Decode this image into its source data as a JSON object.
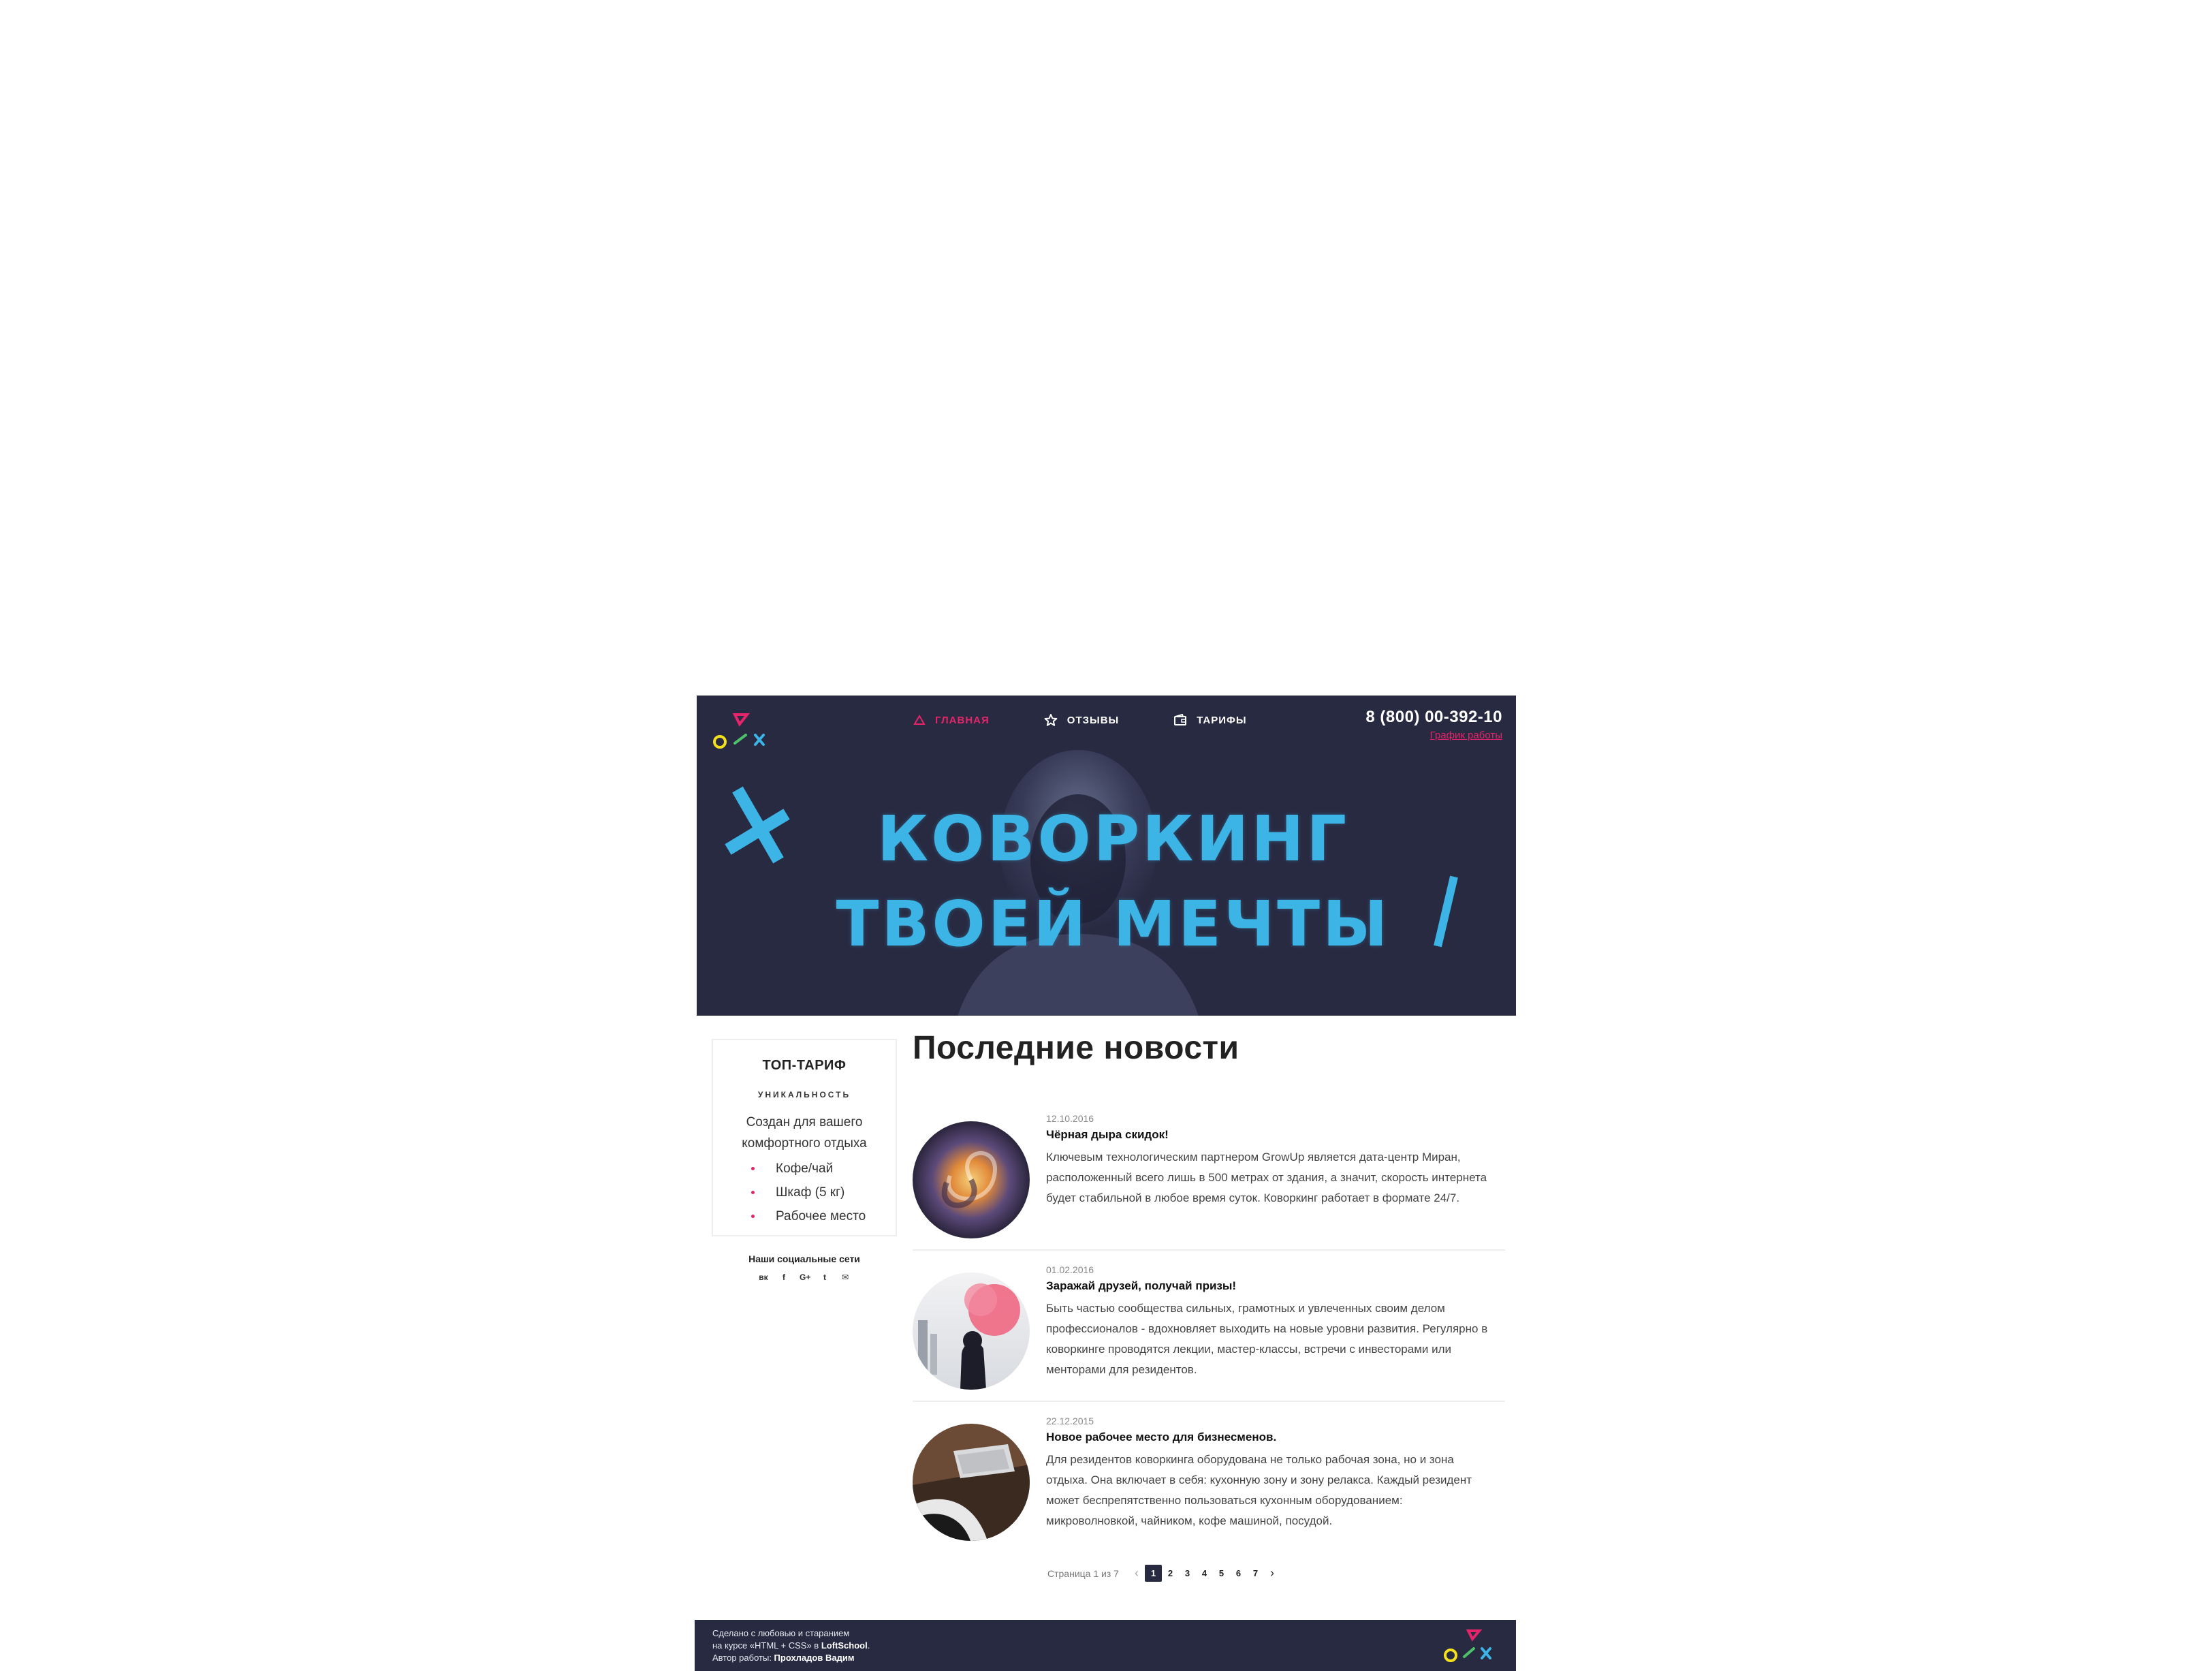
{
  "header": {
    "nav": [
      {
        "label": "Главная",
        "icon": "triangle-icon",
        "active": true
      },
      {
        "label": "Отзывы",
        "icon": "star-icon",
        "active": false
      },
      {
        "label": "Тарифы",
        "icon": "wallet-icon",
        "active": false
      }
    ],
    "phone": "8 (800) 00-392-10",
    "schedule_link": "График работы"
  },
  "hero": {
    "title_line1": "КОВОРКИНГ",
    "title_line2": "ТВОЕЙ МЕЧТЫ"
  },
  "sidebar": {
    "tariff": {
      "title": "ТОП-ТАРИФ",
      "subtitle": "УНИКАЛЬНОСТЬ",
      "description": "Создан для вашего комфортного отдыха",
      "items": [
        "Кофе/чай",
        "Шкаф (5 кг)",
        "Рабочее место"
      ]
    },
    "social": {
      "title": "Наши социальные сети",
      "icons": [
        {
          "name": "vk-icon",
          "glyph": "вк"
        },
        {
          "name": "facebook-icon",
          "glyph": "f"
        },
        {
          "name": "google-plus-icon",
          "glyph": "G+"
        },
        {
          "name": "twitter-icon",
          "glyph": "t"
        },
        {
          "name": "mail-icon",
          "glyph": "✉"
        }
      ]
    }
  },
  "main": {
    "title": "Последние новости",
    "news": [
      {
        "date": "12.10.2016",
        "title": "Чёрная дыра скидок!",
        "text": "Ключевым технологическим партнером GrowUp является дата-центр Миран, расположенный всего лишь в 500 метрах от здания, а значит, скорость интернета будет стабильной в любое время суток. Коворкинг работает в формате 24/7."
      },
      {
        "date": "01.02.2016",
        "title": "Заражай друзей, получай призы!",
        "text": "Быть частью сообщества сильных, грамотных и увлеченных своим делом профессионалов - вдохновляет выходить на новые уровни развития. Регулярно в коворкинге проводятся лекции, мастер-классы, встречи с инвесторами или менторами для резидентов."
      },
      {
        "date": "22.12.2015",
        "title": "Новое рабочее место для бизнесменов.",
        "text": "Для резидентов коворкинга оборудована не только рабочая зона, но и зона отдыха. Она включает в себя: кухонную зону и зону релакса. Каждый резидент может беспрепятственно пользоваться кухонным оборудованием: микроволновкой, чайником, кофе машиной, посудой."
      }
    ],
    "pagination": {
      "label": "Страница 1 из 7",
      "pages": [
        "1",
        "2",
        "3",
        "4",
        "5",
        "6",
        "7"
      ],
      "current": "1",
      "prev": "‹",
      "next": "›"
    }
  },
  "footer": {
    "line1": "Сделано с любовью и старанием",
    "line2_prefix": "на курсе «HTML + CSS» в ",
    "line2_brand": "LoftSchool",
    "line2_suffix": ".",
    "line3_prefix": "Автор работы: ",
    "line3_author": "Прохладов Вадим"
  },
  "colors": {
    "dark_bg": "#282a42",
    "accent_pink": "#e5246a",
    "accent_blue": "#3db4e6",
    "accent_yellow": "#f5e01c",
    "accent_green": "#4cc16a"
  }
}
